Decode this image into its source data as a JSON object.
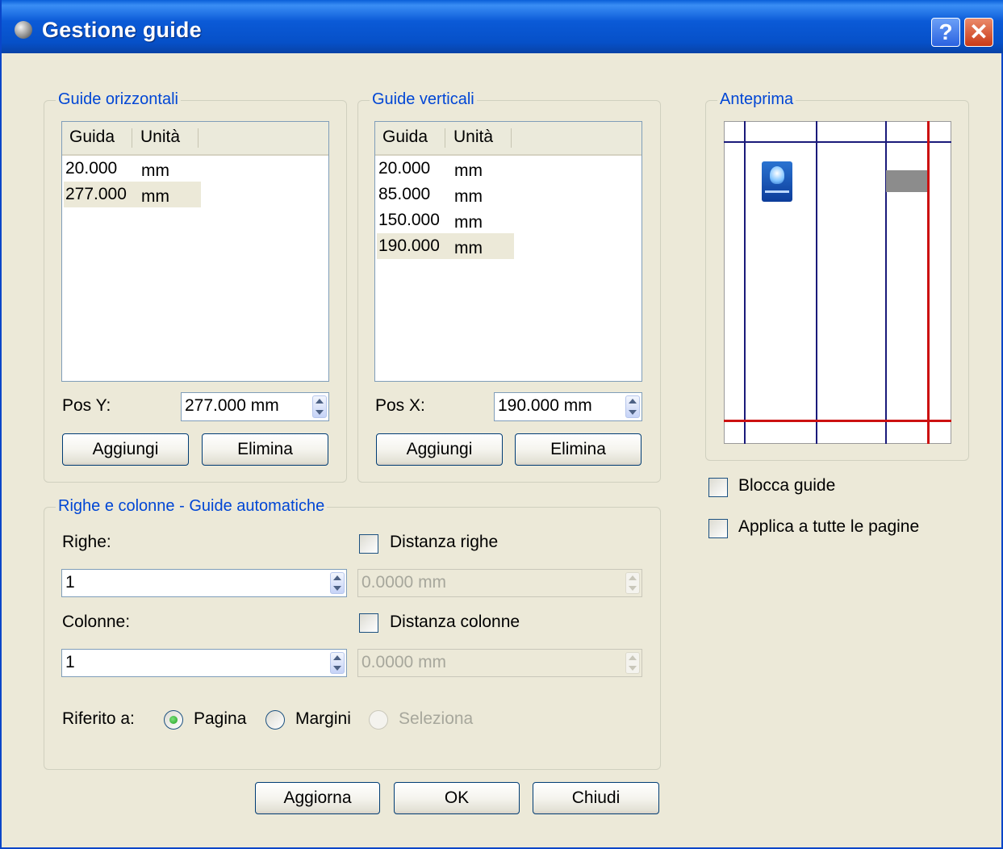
{
  "window": {
    "title": "Gestione guide"
  },
  "horizontal": {
    "legend": "Guide orizzontali",
    "col_guide": "Guida",
    "col_unit": "Unità",
    "rows": [
      {
        "value": "20.000",
        "unit": "mm"
      },
      {
        "value": "277.000",
        "unit": "mm"
      }
    ],
    "pos_label": "Pos Y:",
    "pos_value": "277.000 mm",
    "add_label": "Aggiungi",
    "delete_label": "Elimina"
  },
  "vertical": {
    "legend": "Guide verticali",
    "col_guide": "Guida",
    "col_unit": "Unità",
    "rows": [
      {
        "value": "20.000",
        "unit": "mm"
      },
      {
        "value": "85.000",
        "unit": "mm"
      },
      {
        "value": "150.000",
        "unit": "mm"
      },
      {
        "value": "190.000",
        "unit": "mm"
      }
    ],
    "pos_label": "Pos X:",
    "pos_value": "190.000 mm",
    "add_label": "Aggiungi",
    "delete_label": "Elimina"
  },
  "auto": {
    "legend": "Righe e colonne - Guide automatiche",
    "rows_label": "Righe:",
    "rows_value": "1",
    "row_gap_label": "Distanza righe",
    "row_gap_value": "0.0000 mm",
    "cols_label": "Colonne:",
    "cols_value": "1",
    "col_gap_label": "Distanza colonne",
    "col_gap_value": "0.0000 mm",
    "ref_label": "Riferito a:",
    "ref_page": "Pagina",
    "ref_margins": "Margini",
    "ref_selection": "Seleziona"
  },
  "preview": {
    "legend": "Anteprima"
  },
  "options": {
    "lock_label": "Blocca guide",
    "apply_all_label": "Applica a tutte le pagine"
  },
  "footer": {
    "refresh_label": "Aggiorna",
    "ok_label": "OK",
    "close_label": "Chiudi"
  },
  "colors": {
    "title_bar": "#0b5ad7",
    "legend_text": "#0046d5",
    "guide_line": "#1a1a7a",
    "selected_guide_line": "#cc1111"
  }
}
